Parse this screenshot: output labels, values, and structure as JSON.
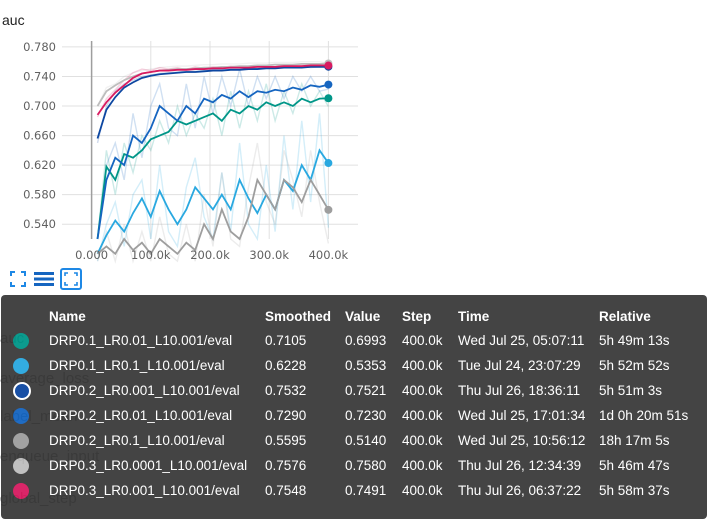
{
  "chart_data": {
    "type": "line",
    "title": "auc",
    "xlabel": "",
    "ylabel": "",
    "xlim": [
      -50000,
      450000
    ],
    "ylim": [
      0.52,
      0.788
    ],
    "x_ticks": [
      "0.000",
      "100.0k",
      "200.0k",
      "300.0k",
      "400.0k"
    ],
    "x_tick_values": [
      0,
      100000,
      200000,
      300000,
      400000
    ],
    "y_ticks": [
      "0.540",
      "0.580",
      "0.620",
      "0.660",
      "0.700",
      "0.740",
      "0.780"
    ],
    "y_tick_values": [
      0.54,
      0.58,
      0.62,
      0.66,
      0.7,
      0.74,
      0.78
    ],
    "grid": true,
    "x": [
      10000,
      25000,
      40000,
      55000,
      70000,
      85000,
      100000,
      115000,
      130000,
      145000,
      160000,
      175000,
      190000,
      205000,
      220000,
      235000,
      250000,
      265000,
      280000,
      295000,
      310000,
      325000,
      340000,
      355000,
      370000,
      385000,
      400000
    ],
    "series": [
      {
        "name": "DRP0.1_LR0.01_L10.001/eval",
        "color": "#009688",
        "smoothed": [
          0.52,
          0.618,
          0.6,
          0.635,
          0.63,
          0.64,
          0.655,
          0.66,
          0.665,
          0.68,
          0.675,
          0.68,
          0.685,
          0.69,
          0.68,
          0.695,
          0.69,
          0.7,
          0.695,
          0.705,
          0.7,
          0.705,
          0.7,
          0.71,
          0.705,
          0.71,
          0.7105
        ],
        "values": [
          0.52,
          0.64,
          0.58,
          0.65,
          0.61,
          0.66,
          0.64,
          0.68,
          0.65,
          0.7,
          0.66,
          0.69,
          0.67,
          0.71,
          0.66,
          0.72,
          0.67,
          0.72,
          0.68,
          0.73,
          0.68,
          0.72,
          0.69,
          0.73,
          0.7,
          0.72,
          0.6993
        ]
      },
      {
        "name": "DRP0.1_LR0.1_L10.001/eval",
        "color": "#29a8e0",
        "smoothed": [
          0.5,
          0.525,
          0.545,
          0.53,
          0.555,
          0.575,
          0.55,
          0.585,
          0.56,
          0.54,
          0.56,
          0.59,
          0.575,
          0.56,
          0.58,
          0.56,
          0.6,
          0.575,
          0.555,
          0.58,
          0.56,
          0.6,
          0.585,
          0.62,
          0.6,
          0.64,
          0.6228
        ],
        "values": [
          0.49,
          0.54,
          0.57,
          0.51,
          0.58,
          0.6,
          0.52,
          0.62,
          0.53,
          0.51,
          0.59,
          0.63,
          0.55,
          0.52,
          0.61,
          0.53,
          0.65,
          0.54,
          0.52,
          0.62,
          0.53,
          0.66,
          0.56,
          0.68,
          0.57,
          0.69,
          0.5353
        ]
      },
      {
        "name": "DRP0.2_LR0.001_L10.001/eval",
        "color": "#0d47a1",
        "smoothed": [
          0.656,
          0.695,
          0.712,
          0.725,
          0.732,
          0.738,
          0.741,
          0.743,
          0.744,
          0.745,
          0.746,
          0.746,
          0.747,
          0.748,
          0.748,
          0.749,
          0.749,
          0.75,
          0.75,
          0.751,
          0.751,
          0.752,
          0.752,
          0.752,
          0.753,
          0.753,
          0.7532
        ],
        "values": [
          0.65,
          0.7,
          0.72,
          0.73,
          0.735,
          0.74,
          0.742,
          0.744,
          0.745,
          0.746,
          0.747,
          0.747,
          0.748,
          0.749,
          0.749,
          0.75,
          0.75,
          0.751,
          0.751,
          0.752,
          0.752,
          0.752,
          0.753,
          0.753,
          0.752,
          0.753,
          0.7521
        ]
      },
      {
        "name": "DRP0.2_LR0.01_L10.001/eval",
        "color": "#1565c0",
        "smoothed": [
          0.52,
          0.6,
          0.63,
          0.62,
          0.66,
          0.65,
          0.67,
          0.7,
          0.69,
          0.68,
          0.7,
          0.69,
          0.71,
          0.705,
          0.715,
          0.71,
          0.72,
          0.712,
          0.72,
          0.718,
          0.722,
          0.72,
          0.725,
          0.722,
          0.728,
          0.726,
          0.729
        ],
        "values": [
          0.52,
          0.62,
          0.65,
          0.6,
          0.69,
          0.63,
          0.7,
          0.73,
          0.67,
          0.66,
          0.73,
          0.67,
          0.74,
          0.69,
          0.74,
          0.7,
          0.75,
          0.7,
          0.74,
          0.71,
          0.74,
          0.71,
          0.74,
          0.72,
          0.74,
          0.72,
          0.723
        ]
      },
      {
        "name": "DRP0.2_LR0.1_L10.001/eval",
        "color": "#9e9e9e",
        "smoothed": [
          0.5,
          0.51,
          0.5,
          0.52,
          0.505,
          0.515,
          0.5,
          0.52,
          0.51,
          0.5,
          0.515,
          0.505,
          0.54,
          0.52,
          0.56,
          0.53,
          0.52,
          0.55,
          0.6,
          0.58,
          0.56,
          0.6,
          0.59,
          0.57,
          0.6,
          0.58,
          0.5595
        ],
        "values": [
          0.49,
          0.53,
          0.49,
          0.54,
          0.49,
          0.53,
          0.49,
          0.55,
          0.5,
          0.49,
          0.54,
          0.49,
          0.58,
          0.51,
          0.61,
          0.52,
          0.51,
          0.59,
          0.65,
          0.57,
          0.54,
          0.64,
          0.6,
          0.55,
          0.64,
          0.57,
          0.514
        ]
      },
      {
        "name": "DRP0.3_LR0.0001_L10.001/eval",
        "color": "#bdbdbd",
        "smoothed": [
          0.7,
          0.72,
          0.728,
          0.735,
          0.74,
          0.744,
          0.746,
          0.748,
          0.749,
          0.75,
          0.75,
          0.751,
          0.752,
          0.752,
          0.753,
          0.753,
          0.754,
          0.754,
          0.755,
          0.755,
          0.756,
          0.756,
          0.756,
          0.757,
          0.757,
          0.757,
          0.7576
        ],
        "values": [
          0.7,
          0.725,
          0.73,
          0.74,
          0.745,
          0.748,
          0.75,
          0.752,
          0.753,
          0.754,
          0.754,
          0.755,
          0.756,
          0.756,
          0.757,
          0.757,
          0.757,
          0.758,
          0.758,
          0.758,
          0.759,
          0.759,
          0.759,
          0.76,
          0.76,
          0.76,
          0.758
        ]
      },
      {
        "name": "DRP0.3_LR0.001_L10.001/eval",
        "color": "#d81b60",
        "smoothed": [
          0.688,
          0.705,
          0.718,
          0.728,
          0.738,
          0.744,
          0.746,
          0.748,
          0.748,
          0.749,
          0.749,
          0.75,
          0.75,
          0.751,
          0.751,
          0.752,
          0.752,
          0.752,
          0.753,
          0.753,
          0.753,
          0.754,
          0.754,
          0.754,
          0.755,
          0.755,
          0.7548
        ],
        "values": [
          0.685,
          0.71,
          0.722,
          0.735,
          0.745,
          0.75,
          0.748,
          0.752,
          0.75,
          0.752,
          0.749,
          0.753,
          0.751,
          0.753,
          0.752,
          0.754,
          0.752,
          0.754,
          0.753,
          0.755,
          0.753,
          0.755,
          0.754,
          0.756,
          0.755,
          0.756,
          0.7491
        ]
      }
    ]
  },
  "toolbar": {
    "icons": [
      "expand-icon",
      "list-icon",
      "fit-domain-icon"
    ]
  },
  "background_labels": [
    "auc",
    "average_loss",
    "label_mean",
    "enqueue_input",
    "global_step"
  ],
  "tooltip": {
    "headers": [
      "Name",
      "Smoothed",
      "Value",
      "Step",
      "Time",
      "Relative"
    ],
    "rows": [
      {
        "color": "#009688",
        "hollow": false,
        "name": "DRP0.1_LR0.01_L10.001/eval",
        "smoothed": "0.7105",
        "value": "0.6993",
        "step": "400.0k",
        "time": "Wed Jul 25, 05:07:11",
        "relative": "5h 49m 13s"
      },
      {
        "color": "#29a8e0",
        "hollow": false,
        "name": "DRP0.1_LR0.1_L10.001/eval",
        "smoothed": "0.6228",
        "value": "0.5353",
        "step": "400.0k",
        "time": "Tue Jul 24, 23:07:29",
        "relative": "5h 52m 52s"
      },
      {
        "color": "#0d47a1",
        "hollow": true,
        "name": "DRP0.2_LR0.001_L10.001/eval",
        "smoothed": "0.7532",
        "value": "0.7521",
        "step": "400.0k",
        "time": "Thu Jul 26, 18:36:11",
        "relative": "5h 51m 3s"
      },
      {
        "color": "#1565c0",
        "hollow": false,
        "name": "DRP0.2_LR0.01_L10.001/eval",
        "smoothed": "0.7290",
        "value": "0.7230",
        "step": "400.0k",
        "time": "Wed Jul 25, 17:01:34",
        "relative": "1d 0h 20m 51s"
      },
      {
        "color": "#9e9e9e",
        "hollow": false,
        "name": "DRP0.2_LR0.1_L10.001/eval",
        "smoothed": "0.5595",
        "value": "0.5140",
        "step": "400.0k",
        "time": "Wed Jul 25, 10:56:12",
        "relative": "18h 17m 5s"
      },
      {
        "color": "#bdbdbd",
        "hollow": false,
        "name": "DRP0.3_LR0.0001_L10.001/eval",
        "smoothed": "0.7576",
        "value": "0.7580",
        "step": "400.0k",
        "time": "Thu Jul 26, 12:34:39",
        "relative": "5h 46m 47s"
      },
      {
        "color": "#d81b60",
        "hollow": false,
        "name": "DRP0.3_LR0.001_L10.001/eval",
        "smoothed": "0.7548",
        "value": "0.7491",
        "step": "400.0k",
        "time": "Thu Jul 26, 06:37:22",
        "relative": "5h 58m 37s"
      }
    ]
  }
}
